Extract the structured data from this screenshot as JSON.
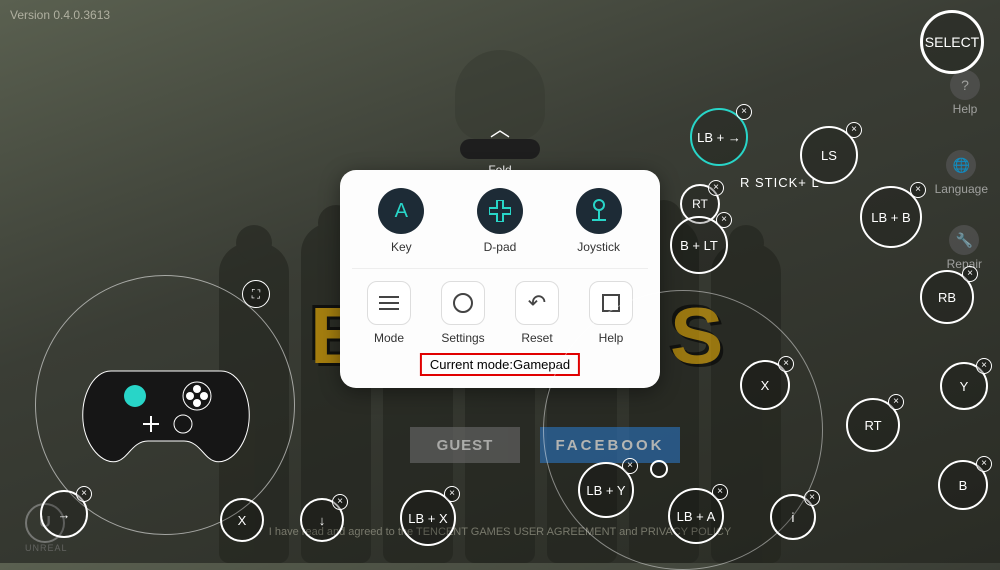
{
  "version": "Version 0.4.0.3613",
  "fold": {
    "label": "Fold"
  },
  "panel": {
    "tools_top": {
      "key": "Key",
      "dpad": "D-pad",
      "joystick": "Joystick"
    },
    "tools_bottom": {
      "mode": "Mode",
      "settings": "Settings",
      "reset": "Reset",
      "help": "Help"
    },
    "current_mode": "Current mode:Gamepad"
  },
  "side": {
    "help": "Help",
    "language": "Language",
    "repair": "Repair"
  },
  "bg_buttons": {
    "guest": "GUEST",
    "facebook": "FACEBOOK"
  },
  "agreement": "I have read and agreed to the TENCENT GAMES USER AGREEMENT and PRIVACY POLICY",
  "unreal": "UNREAL",
  "stick_label": "R STICK+ L",
  "mappings": {
    "select": "SELECT",
    "lb_right": "LB + →",
    "ls": "LS",
    "rt_small": "RT",
    "b_lt": "B + LT",
    "lb_b": "LB + B",
    "rb": "RB",
    "x": "X",
    "y": "Y",
    "rt": "RT",
    "b": "B",
    "lb_y": "LB + Y",
    "lb_a": "LB + A",
    "i_dot": "i",
    "lb_x": "LB + X",
    "down_arrow": "↓",
    "x_close": "X",
    "right_arrow": "→"
  }
}
